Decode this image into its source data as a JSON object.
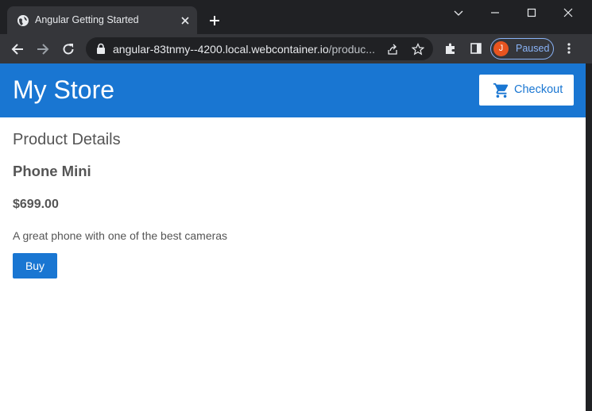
{
  "browser": {
    "tab_title": "Angular Getting Started",
    "url_host": "angular-83tnmy--4200.local.webcontainer.io",
    "url_path": "/produc...",
    "profile_initial": "J",
    "profile_status": "Paused",
    "accent_color": "#8ab4f8",
    "avatar_color": "#e8541f"
  },
  "header": {
    "title": "My Store",
    "checkout_label": "Checkout",
    "brand_color": "#1976d2"
  },
  "main": {
    "section_title": "Product Details",
    "product": {
      "name": "Phone Mini",
      "price": "$699.00",
      "description": "A great phone with one of the best cameras"
    },
    "buy_label": "Buy"
  }
}
